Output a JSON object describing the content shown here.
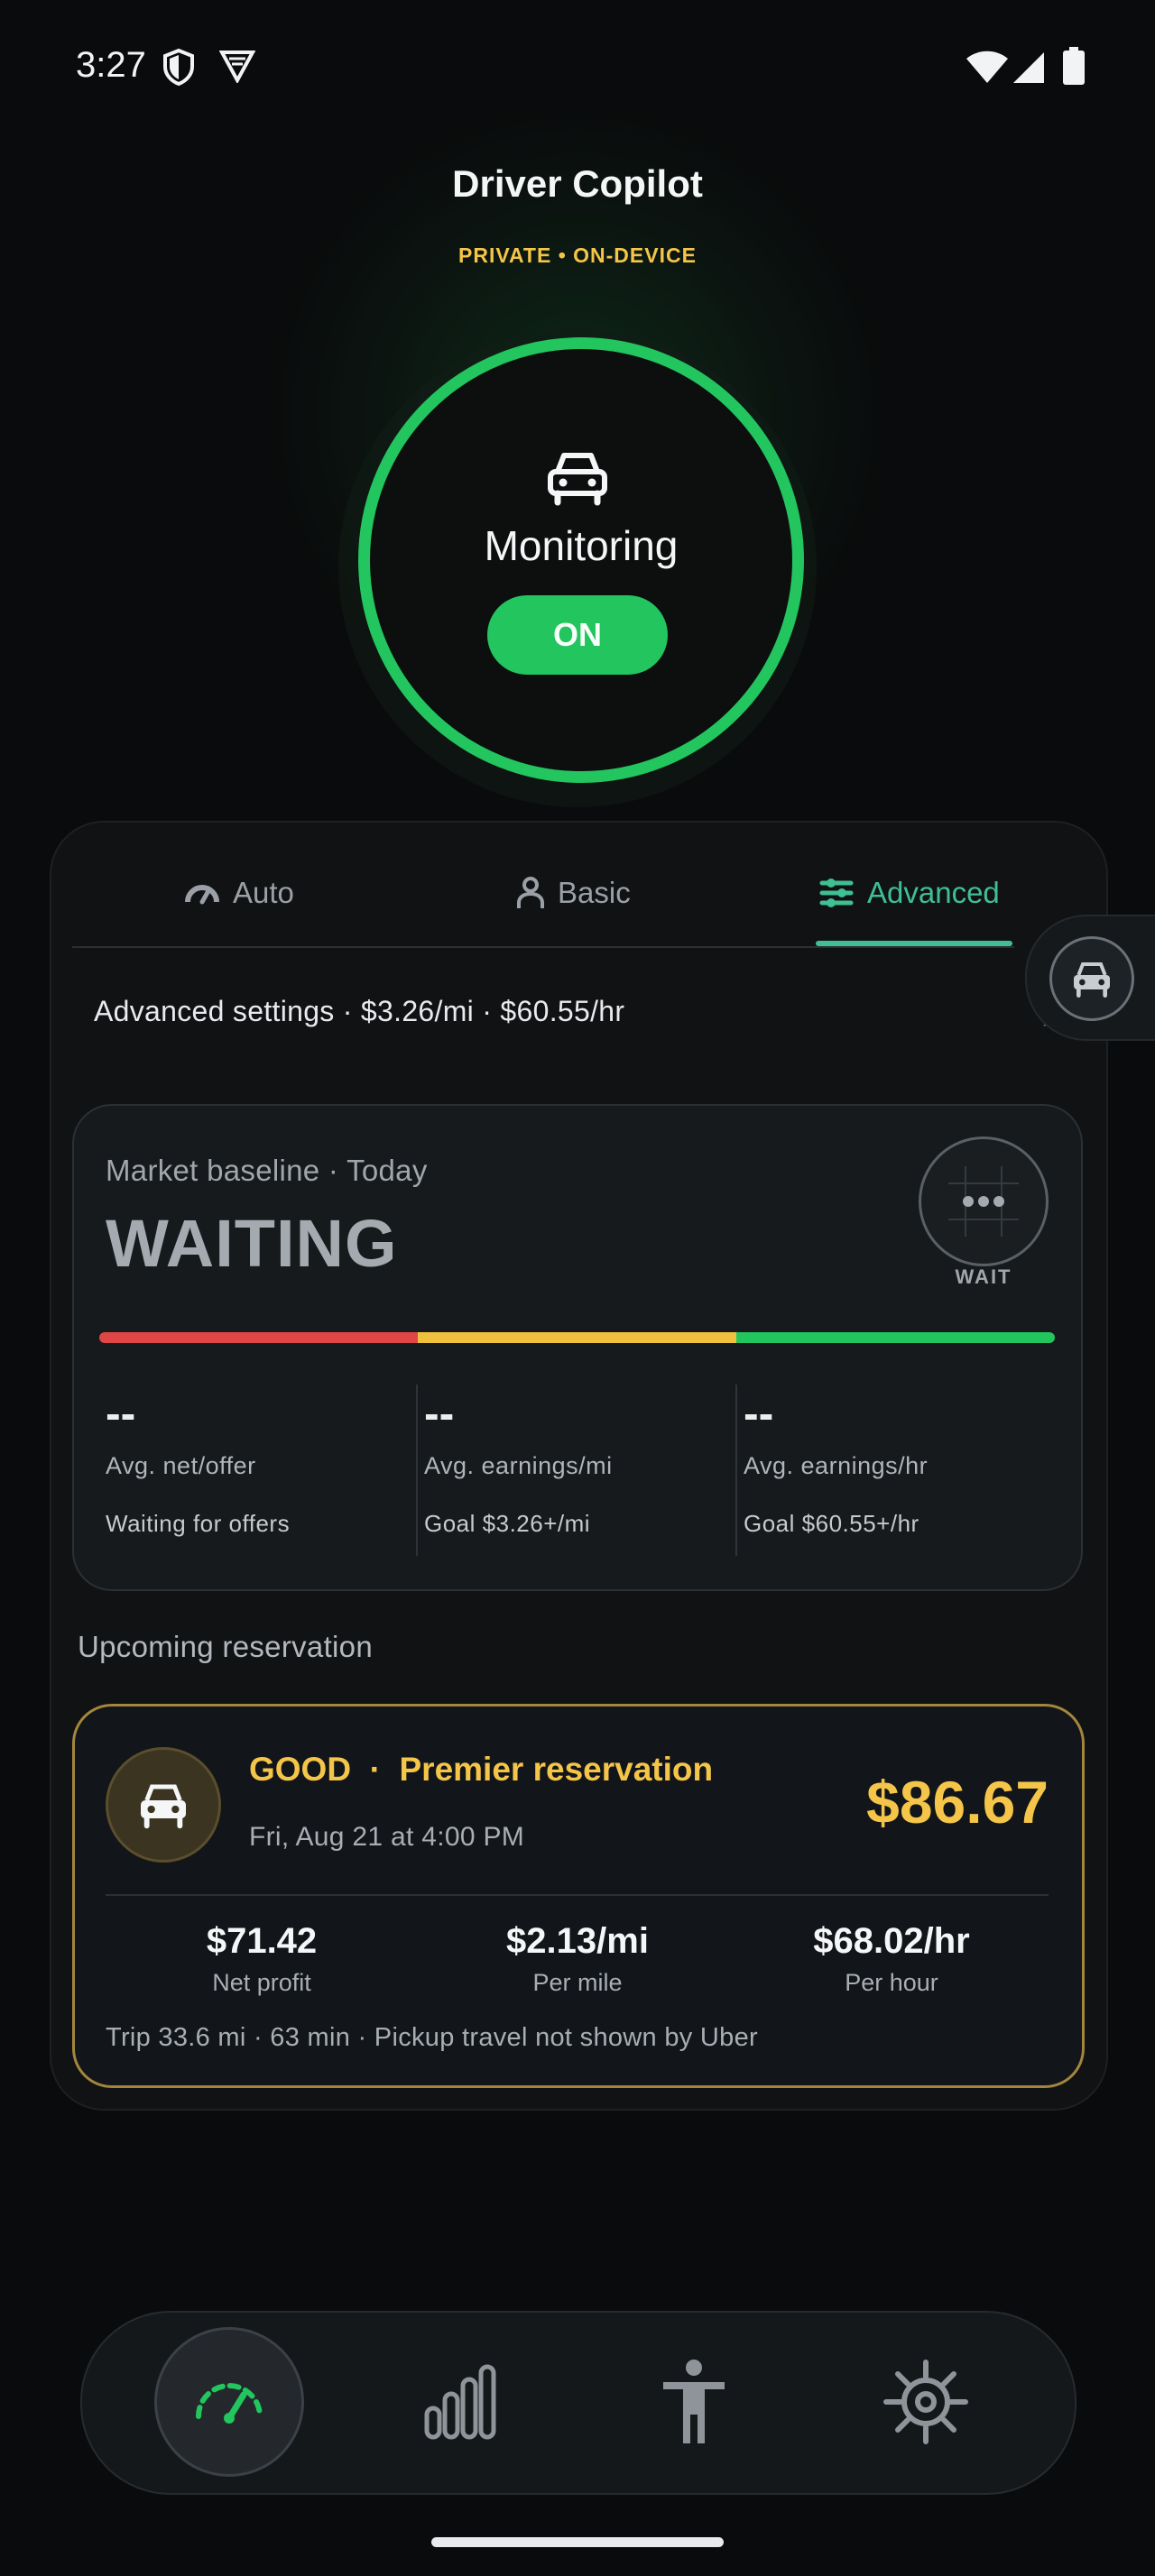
{
  "status_bar": {
    "time": "3:27",
    "icons": [
      "shield-icon",
      "vpn-icon",
      "wifi-icon",
      "signal-icon",
      "battery-icon"
    ]
  },
  "header": {
    "title": "Driver Copilot",
    "subtitle": "PRIVATE • ON-DEVICE"
  },
  "monitor": {
    "icon": "car-icon",
    "label": "Monitoring",
    "toggle_label": "ON"
  },
  "tabs": [
    {
      "label": "Auto",
      "icon": "gauge-icon",
      "active": false
    },
    {
      "label": "Basic",
      "icon": "person-icon",
      "active": false
    },
    {
      "label": "Advanced",
      "icon": "sliders-icon",
      "active": true
    }
  ],
  "settings_summary": "Advanced settings · $3.26/mi · $60.55/hr",
  "market": {
    "title": "Market baseline · Today",
    "status": "WAITING",
    "badge_label": "WAIT",
    "stats": [
      {
        "value": "--",
        "label": "Avg. net/offer",
        "sub": "Waiting for offers"
      },
      {
        "value": "--",
        "label": "Avg. earnings/mi",
        "sub": "Goal $3.26+/mi"
      },
      {
        "value": "--",
        "label": "Avg. earnings/hr",
        "sub": "Goal $60.55+/hr"
      }
    ]
  },
  "upcoming": {
    "section_title": "Upcoming reservation",
    "heading": "GOOD  ·  Premier reservation",
    "date": "Fri, Aug 21 at 4:00 PM",
    "price": "$86.67",
    "metrics": [
      {
        "value": "$71.42",
        "label": "Net profit"
      },
      {
        "value": "$2.13/mi",
        "label": "Per mile"
      },
      {
        "value": "$68.02/hr",
        "label": "Per hour"
      }
    ],
    "footer": "Trip 33.6 mi · 63 min · Pickup travel not shown by Uber"
  },
  "nav": [
    {
      "icon": "speedometer-icon",
      "active": true
    },
    {
      "icon": "bar-chart-icon",
      "active": false
    },
    {
      "icon": "accessibility-icon",
      "active": false
    },
    {
      "icon": "settings-icon",
      "active": false
    }
  ],
  "colors": {
    "accent_green": "#22c55e",
    "tab_active": "#3fbf92",
    "gold": "#f4c548",
    "meter": [
      "#e04646",
      "#f0c13c",
      "#22c55e"
    ]
  }
}
